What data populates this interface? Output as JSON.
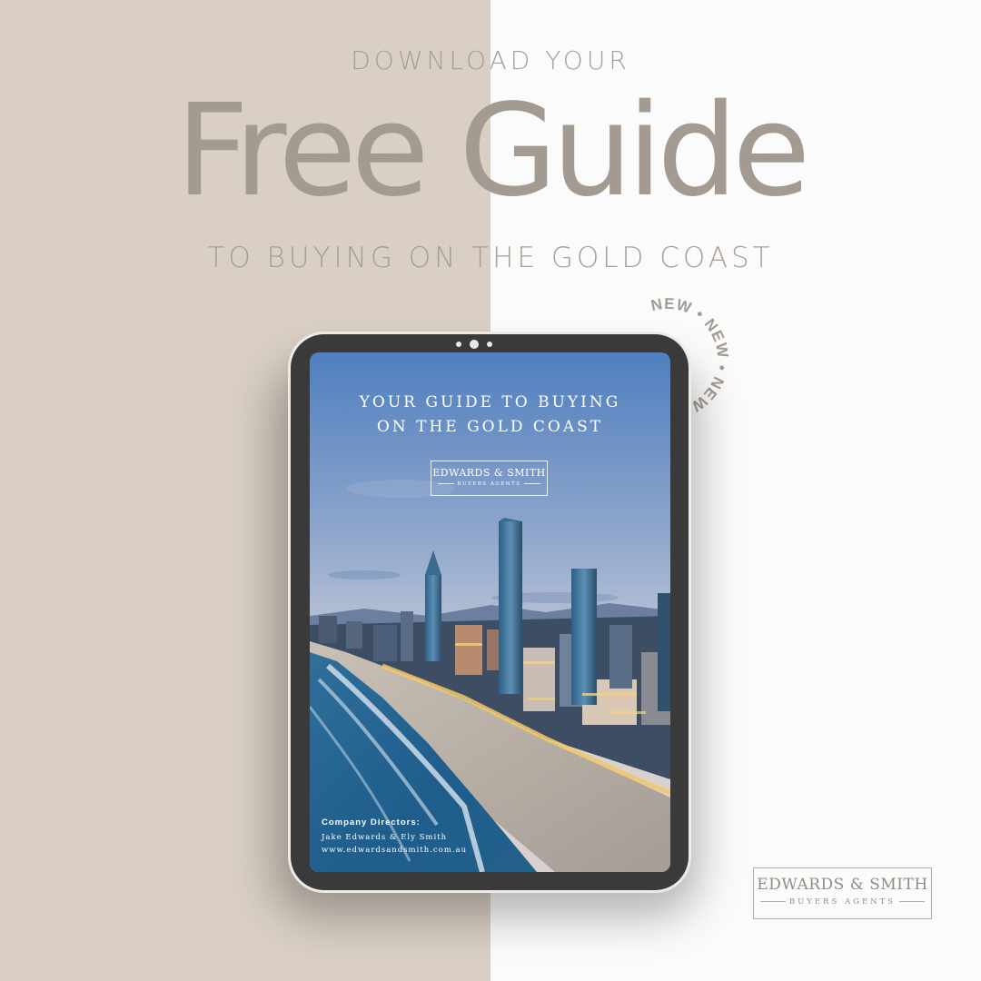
{
  "header": {
    "pre_title": "DOWNLOAD YOUR",
    "title": "Free Guide",
    "subtitle": "TO BUYING ON THE GOLD COAST"
  },
  "badge": {
    "text": "NEW • NEW • NEW • NEW • NEW •"
  },
  "tablet": {
    "screen": {
      "title_line1": "YOUR GUIDE TO BUYING",
      "title_line2": "ON THE GOLD COAST",
      "logo_name": "EDWARDS & SMITH",
      "logo_tagline": "BUYERS AGENTS",
      "footer_heading": "Company Directors:",
      "footer_names": "Jake Edwards & Ely Smith",
      "footer_url": "www.edwardsandsmith.com.au"
    }
  },
  "corner_logo": {
    "name": "EDWARDS & SMITH",
    "tagline": "BUYERS AGENTS"
  },
  "colors": {
    "left_panel": "#d9cfc4",
    "right_panel": "#fbfbfb",
    "text_taupe": "#a39b91",
    "tablet_bezel": "#3a3a3a"
  }
}
